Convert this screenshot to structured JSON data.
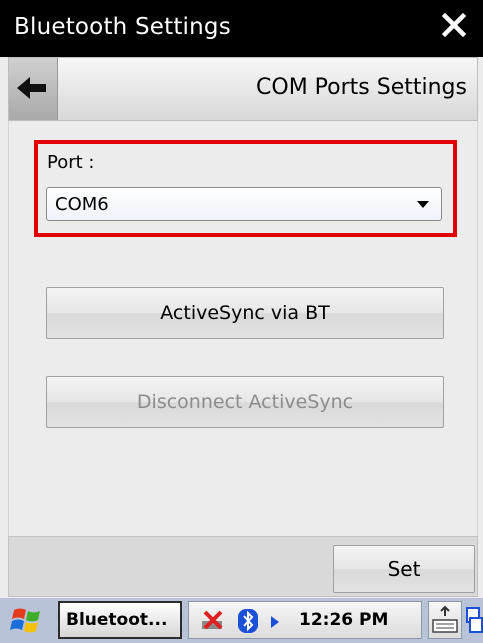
{
  "window": {
    "title": "Bluetooth Settings",
    "close_icon": "close-icon"
  },
  "header": {
    "title": "COM Ports Settings",
    "back_icon": "arrow-left-icon"
  },
  "port": {
    "label": "Port :",
    "selected": "COM6"
  },
  "buttons": {
    "activesync": "ActiveSync via BT",
    "disconnect": "Disconnect ActiveSync",
    "set": "Set"
  },
  "taskbar": {
    "app_label": "Bluetoot...",
    "time": "12:26 PM",
    "icons": [
      "start-flag-icon",
      "network-disconnected-icon",
      "bluetooth-icon",
      "tray-expand-icon",
      "keyboard-icon",
      "window-switch-icon"
    ]
  },
  "colors": {
    "highlight": "#e00000",
    "titlebar": "#000000",
    "taskbar": "#b8c3d7"
  }
}
